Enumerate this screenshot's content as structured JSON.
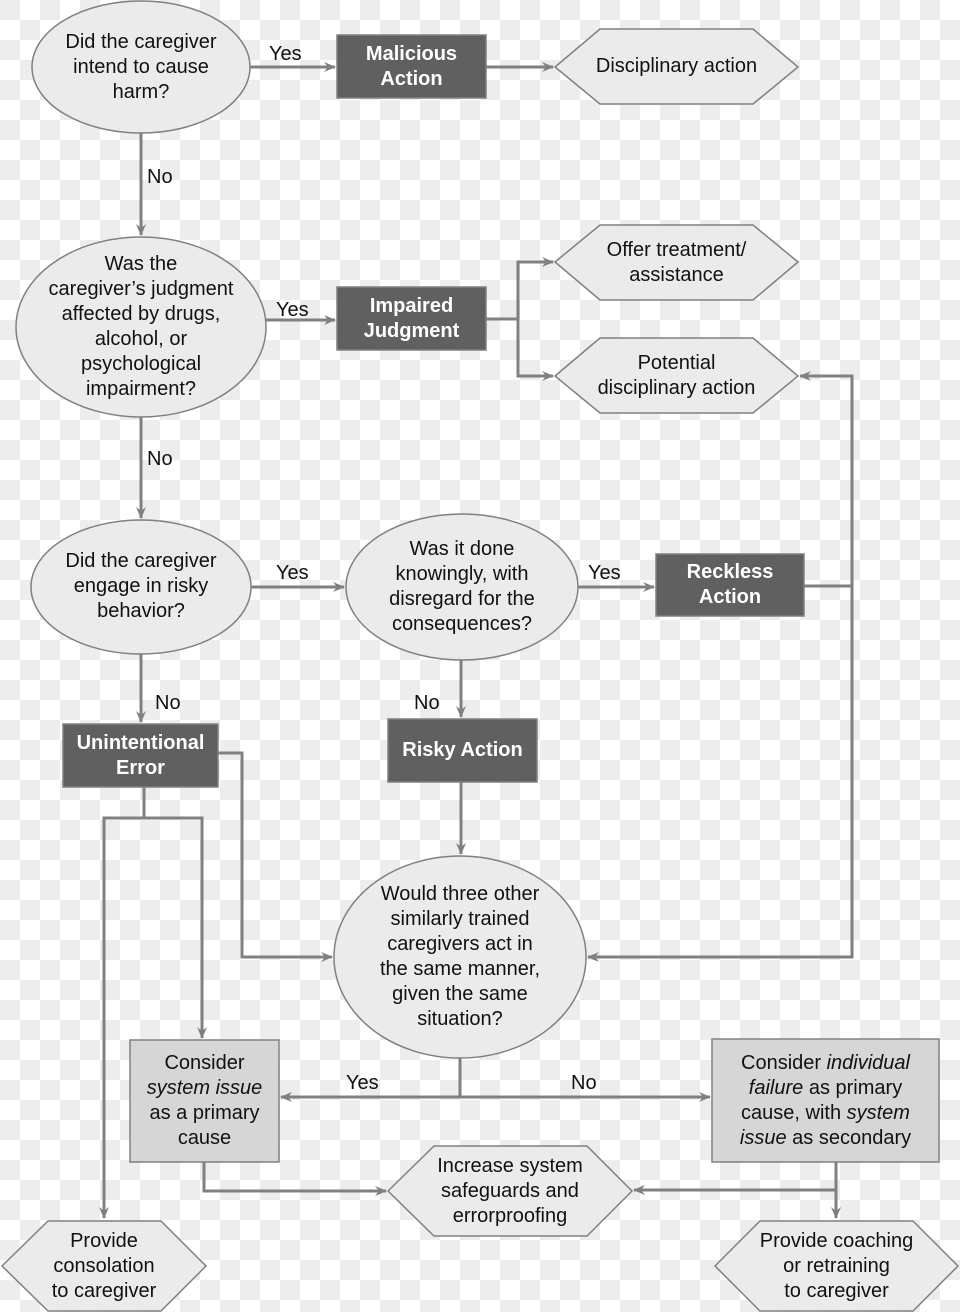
{
  "diagram": {
    "type": "flowchart",
    "title_visible": false,
    "colors": {
      "decision_fill": "#ebebeb",
      "outcome_box_fill": "#606060",
      "consider_box_fill": "#d6d6d6",
      "action_hex_fill": "#ebebeb",
      "stroke": "#808080",
      "text": "#111111",
      "outcome_text": "#ffffff"
    },
    "nodes": {
      "q_intent": {
        "shape": "ellipse",
        "lines": [
          "Did the caregiver",
          "intend to cause",
          "harm?"
        ]
      },
      "malicious": {
        "shape": "box-dark",
        "lines": [
          "Malicious",
          "Action"
        ]
      },
      "disciplinary": {
        "shape": "hexagon",
        "lines": [
          "Disciplinary action"
        ]
      },
      "q_impaired": {
        "shape": "ellipse",
        "lines": [
          "Was the",
          "caregiver’s judgment",
          "affected by drugs,",
          "alcohol, or",
          "psychological",
          "impairment?"
        ]
      },
      "impaired": {
        "shape": "box-dark",
        "lines": [
          "Impaired",
          "Judgment"
        ]
      },
      "offer_treatment": {
        "shape": "hexagon",
        "lines": [
          "Offer treatment/",
          "assistance"
        ]
      },
      "potential_disciplinary": {
        "shape": "hexagon",
        "lines": [
          "Potential",
          "disciplinary action"
        ]
      },
      "q_risky": {
        "shape": "ellipse",
        "lines": [
          "Did the caregiver",
          "engage in risky",
          "behavior?"
        ]
      },
      "q_knowingly": {
        "shape": "ellipse",
        "lines": [
          "Was it done",
          "knowingly, with",
          "disregard for the",
          "consequences?"
        ]
      },
      "reckless": {
        "shape": "box-dark",
        "lines": [
          "Reckless",
          "Action"
        ]
      },
      "unintentional": {
        "shape": "box-dark",
        "lines": [
          "Unintentional",
          "Error"
        ]
      },
      "risky_action": {
        "shape": "box-dark",
        "lines": [
          "Risky Action"
        ]
      },
      "q_three_others": {
        "shape": "ellipse",
        "lines": [
          "Would three other",
          "similarly trained",
          "caregivers act in",
          "the same manner,",
          "given the same",
          "situation?"
        ]
      },
      "consider_system": {
        "shape": "box-light",
        "lines": [
          "Consider",
          "<em>system issue</em>",
          "as a primary",
          "cause"
        ]
      },
      "consider_individual": {
        "shape": "box-light",
        "lines": [
          "Consider <em>individual</em>",
          "<em>failure</em> as primary",
          "cause, with <em>system</em>",
          "<em>issue</em> as secondary"
        ]
      },
      "increase_safeguards": {
        "shape": "hexagon",
        "lines": [
          "Increase system",
          "safeguards and",
          "errorproofing"
        ]
      },
      "consolation": {
        "shape": "hexagon",
        "lines": [
          "Provide",
          "consolation",
          "to caregiver"
        ]
      },
      "coaching": {
        "shape": "hexagon",
        "lines": [
          "Provide coaching",
          "or retraining",
          "to caregiver"
        ]
      }
    },
    "edge_labels": {
      "intent_yes": "Yes",
      "intent_no": "No",
      "impaired_yes": "Yes",
      "impaired_no": "No",
      "risky_yes": "Yes",
      "risky_no": "No",
      "knowingly_yes": "Yes",
      "knowingly_no": "No",
      "three_yes": "Yes",
      "three_no": "No"
    },
    "edges": [
      {
        "from": "q_intent",
        "to": "malicious",
        "label": "Yes"
      },
      {
        "from": "malicious",
        "to": "disciplinary"
      },
      {
        "from": "q_intent",
        "to": "q_impaired",
        "label": "No"
      },
      {
        "from": "q_impaired",
        "to": "impaired",
        "label": "Yes"
      },
      {
        "from": "impaired",
        "to": "offer_treatment"
      },
      {
        "from": "impaired",
        "to": "potential_disciplinary"
      },
      {
        "from": "q_impaired",
        "to": "q_risky",
        "label": "No"
      },
      {
        "from": "q_risky",
        "to": "q_knowingly",
        "label": "Yes"
      },
      {
        "from": "q_knowingly",
        "to": "reckless",
        "label": "Yes"
      },
      {
        "from": "reckless",
        "to": "potential_disciplinary"
      },
      {
        "from": "reckless",
        "to": "q_three_others"
      },
      {
        "from": "q_risky",
        "to": "unintentional",
        "label": "No"
      },
      {
        "from": "q_knowingly",
        "to": "risky_action",
        "label": "No"
      },
      {
        "from": "risky_action",
        "to": "q_three_others"
      },
      {
        "from": "unintentional",
        "to": "q_three_others"
      },
      {
        "from": "unintentional",
        "to": "consider_system"
      },
      {
        "from": "unintentional",
        "to": "consolation"
      },
      {
        "from": "q_three_others",
        "to": "consider_system",
        "label": "Yes"
      },
      {
        "from": "q_three_others",
        "to": "consider_individual",
        "label": "No"
      },
      {
        "from": "consider_system",
        "to": "increase_safeguards"
      },
      {
        "from": "consider_individual",
        "to": "increase_safeguards"
      },
      {
        "from": "consider_individual",
        "to": "coaching"
      }
    ]
  }
}
